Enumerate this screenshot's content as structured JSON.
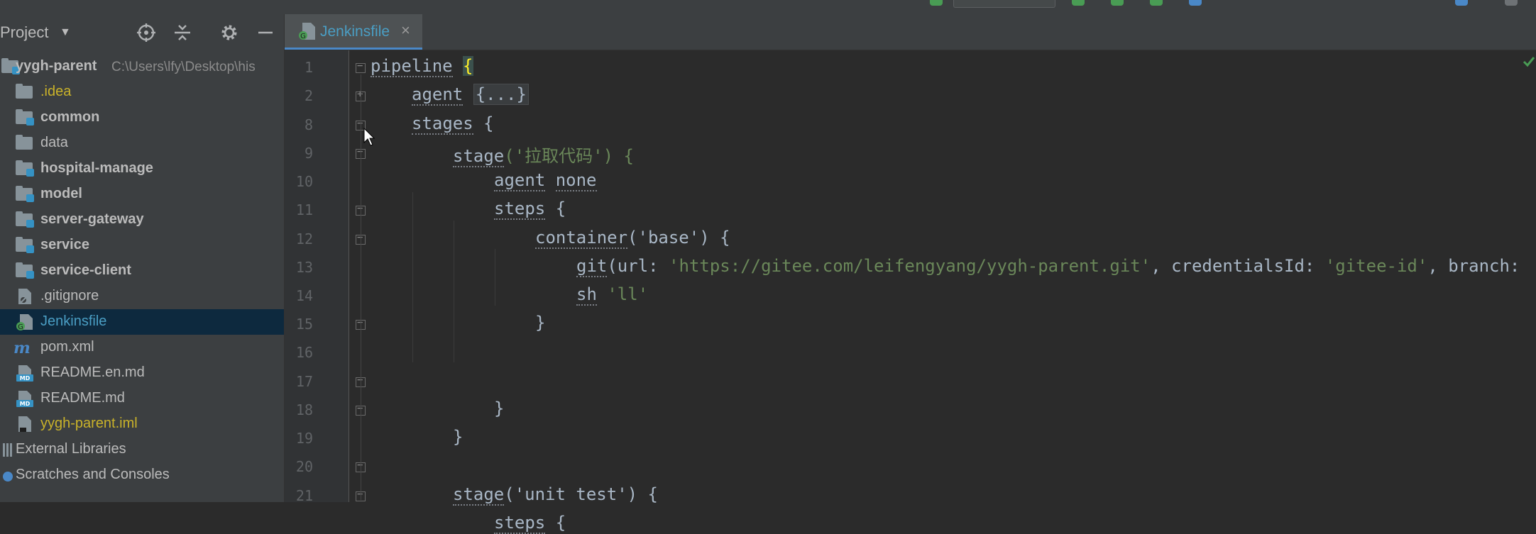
{
  "colors": {
    "accent": "#4a88c7",
    "selected_bg": "#0d293e",
    "string": "#6a8759",
    "module_badge": "#3592c4"
  },
  "project": {
    "title": "Project",
    "root": {
      "name": "yygh-parent",
      "path": "C:\\Users\\lfy\\Desktop\\his"
    },
    "items": [
      {
        "label": ".idea",
        "icon": "folder-icon"
      },
      {
        "label": "common",
        "icon": "module-folder-icon"
      },
      {
        "label": "data",
        "icon": "folder-icon"
      },
      {
        "label": "hospital-manage",
        "icon": "module-folder-icon"
      },
      {
        "label": "model",
        "icon": "module-folder-icon"
      },
      {
        "label": "server-gateway",
        "icon": "module-folder-icon"
      },
      {
        "label": "service",
        "icon": "module-folder-icon"
      },
      {
        "label": "service-client",
        "icon": "module-folder-icon"
      },
      {
        "label": ".gitignore",
        "icon": "gitignore-file-icon"
      },
      {
        "label": "Jenkinsfile",
        "icon": "jenkins-file-icon"
      },
      {
        "label": "pom.xml",
        "icon": "maven-file-icon"
      },
      {
        "label": "README.en.md",
        "icon": "markdown-file-icon"
      },
      {
        "label": "README.md",
        "icon": "markdown-file-icon"
      },
      {
        "label": "yygh-parent.iml",
        "icon": "iml-file-icon"
      },
      {
        "label": "External Libraries",
        "icon": "library-icon"
      },
      {
        "label": "Scratches and Consoles",
        "icon": "scratches-icon"
      }
    ]
  },
  "editor": {
    "tab": {
      "label": "Jenkinsfile",
      "close": "×"
    },
    "folded_placeholder": "{...}",
    "line_numbers": [
      "1",
      "2",
      "8",
      "9",
      "10",
      "11",
      "12",
      "13",
      "14",
      "15",
      "16",
      "17",
      "18",
      "19",
      "20",
      "21"
    ],
    "lines": {
      "l1_kw": "pipeline",
      "l1_brace": "{",
      "l2_kw": "agent",
      "l3_kw": "stages",
      "l3_rest": " {",
      "l4_kw": "stage",
      "l4_rest": "('拉取代码') {",
      "l5_kw": "agent",
      "l5_rest": " ",
      "l5_kw2": "none",
      "l6_kw": "steps",
      "l6_rest": " {",
      "l7_kw": "container",
      "l7_rest": "('base') {",
      "l8_kw": "git",
      "l8_p1": "(url: ",
      "l8_s1": "'https://gitee.com/leifengyang/yygh-parent.git'",
      "l8_p2": ", credentialsId: ",
      "l8_s2": "'gitee-id'",
      "l8_p3": ", branch:",
      "l9_kw": "sh",
      "l9_rest": " ",
      "l9_s": "'ll'",
      "l10": "}",
      "l12": "}",
      "l13": "}",
      "l15_kw": "stage",
      "l15_rest": "('unit test') {",
      "l16_kw": "steps",
      "l16_rest": " {"
    }
  }
}
